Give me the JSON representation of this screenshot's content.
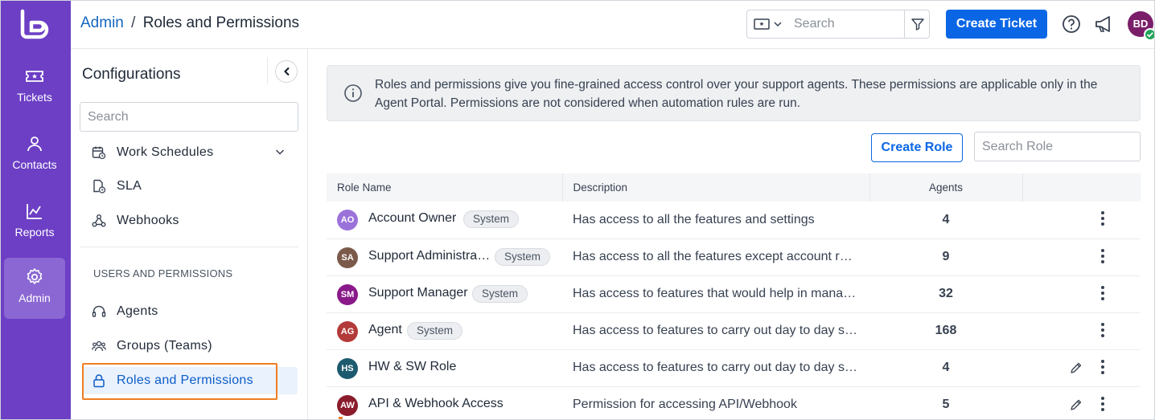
{
  "nav": {
    "items": [
      {
        "label": "Tickets",
        "icon": "ticket-icon"
      },
      {
        "label": "Contacts",
        "icon": "person-icon"
      },
      {
        "label": "Reports",
        "icon": "chart-icon"
      },
      {
        "label": "Admin",
        "icon": "gear-icon",
        "active": true
      }
    ]
  },
  "header": {
    "breadcrumb_root": "Admin",
    "breadcrumb_sep": "/",
    "breadcrumb_current": "Roles and Permissions",
    "search_placeholder": "Search",
    "create_ticket": "Create Ticket",
    "avatar_initials": "BD"
  },
  "config": {
    "title": "Configurations",
    "search_placeholder": "Search",
    "items_top": [
      {
        "label": "Work Schedules",
        "icon": "calendar-clock-icon",
        "expandable": true
      },
      {
        "label": "SLA",
        "icon": "document-clock-icon"
      },
      {
        "label": "Webhooks",
        "icon": "webhook-icon"
      }
    ],
    "section_label": "USERS AND PERMISSIONS",
    "items_users": [
      {
        "label": "Agents",
        "icon": "headset-icon"
      },
      {
        "label": "Groups (Teams)",
        "icon": "group-icon"
      },
      {
        "label": "Roles and Permissions",
        "icon": "lock-icon",
        "selected": true
      }
    ]
  },
  "notice": {
    "text": "Roles and permissions give you fine-grained access control over your support agents. These permissions are applicable only in the Agent Portal. Permissions are not considered when automation rules are run."
  },
  "toolbar": {
    "create_role": "Create Role",
    "search_role_placeholder": "Search Role"
  },
  "table": {
    "headers": [
      "Role Name",
      "Description",
      "Agents",
      ""
    ],
    "rows": [
      {
        "initials": "AO",
        "name": "Account Owner",
        "tag": "System",
        "description": "Has access to all the features and settings",
        "agents": "4",
        "editable": false,
        "color": "#9b72d9"
      },
      {
        "initials": "SA",
        "name": "Support Administrator",
        "tag": "System",
        "description": "Has access to all the features except account related settings",
        "agents": "9",
        "editable": false,
        "color": "#7b5a4b"
      },
      {
        "initials": "SM",
        "name": "Support Manager",
        "tag": "System",
        "description": "Has access to features that would help in managing the team",
        "agents": "32",
        "editable": false,
        "color": "#8a1a8a"
      },
      {
        "initials": "AG",
        "name": "Agent",
        "tag": "System",
        "description": "Has access to features to carry out day to day support activities",
        "agents": "168",
        "editable": false,
        "color": "#b33a3a"
      },
      {
        "initials": "HS",
        "name": "HW & SW Role",
        "tag": "",
        "description": "Has access to features to carry out day to day support activities",
        "agents": "4",
        "editable": true,
        "color": "#1d5a6e"
      },
      {
        "initials": "AW",
        "name": "API & Webhook Access",
        "tag": "",
        "description": "Permission for accessing API/Webhook",
        "agents": "5",
        "editable": true,
        "color": "#8a1c2c"
      }
    ]
  },
  "colors": {
    "rail": "#6c3fc5",
    "primary": "#0a66e5",
    "highlight": "#ef7d22"
  }
}
